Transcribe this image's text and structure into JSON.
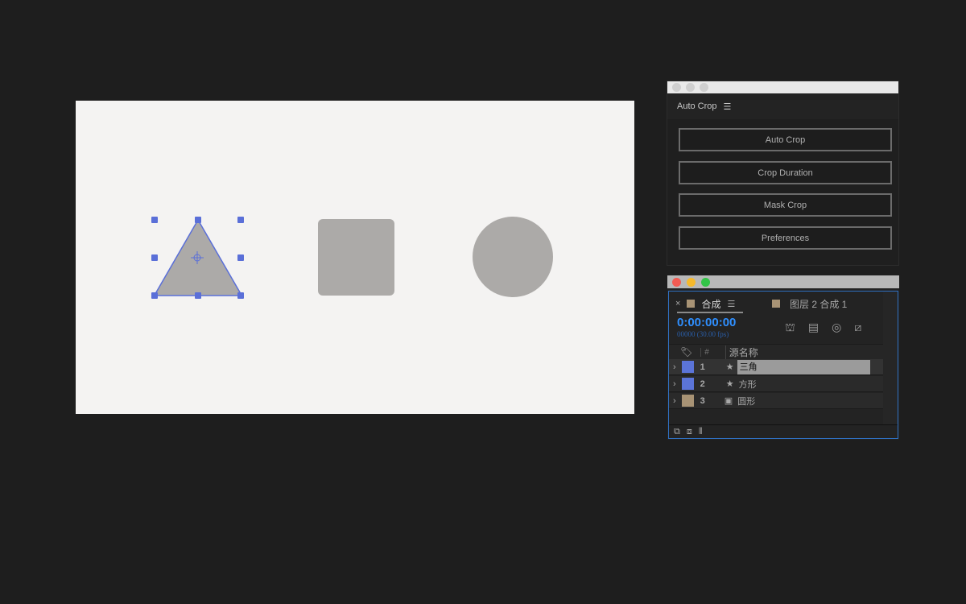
{
  "panel": {
    "title": "Auto Crop",
    "buttons": [
      "Auto Crop",
      "Crop Duration",
      "Mask Crop",
      "Preferences"
    ]
  },
  "timeline": {
    "tab_active": "合成",
    "tab_other": "图层 2 合成 1",
    "timecode": "0:00:00:00",
    "frames": "00000 (30.00 fps)",
    "col_num": "#",
    "col_name": "源名称",
    "layers": [
      {
        "num": "1",
        "name": "三角",
        "color": "#5b74d8",
        "selected": true
      },
      {
        "num": "2",
        "name": "方形",
        "color": "#5b74d8"
      },
      {
        "num": "3",
        "name": "圆形",
        "color": "#a89375"
      }
    ]
  },
  "colors": {
    "accent": "#2f8fff",
    "handle": "#5a6fd8",
    "shape": "#acaaa8"
  }
}
